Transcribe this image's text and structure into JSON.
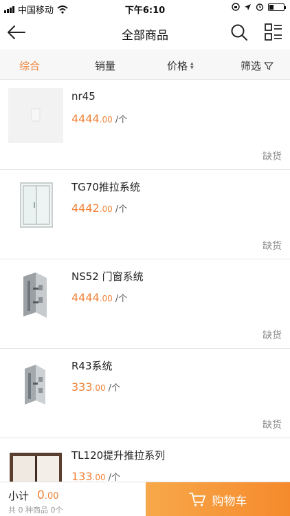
{
  "status_bar": {
    "carrier": "中国移动",
    "time": "下午6:10",
    "battery_level": 0.3
  },
  "header": {
    "title": "全部商品",
    "icons": [
      "back-arrow-icon",
      "search-icon",
      "list-view-icon"
    ]
  },
  "sort_bar": {
    "items": [
      {
        "label": "综合"
      },
      {
        "label": "销量"
      },
      {
        "label": "价格"
      },
      {
        "label": "筛选"
      }
    ],
    "active_index": 0,
    "icons": [
      "sort-arrows-icon",
      "filter-icon"
    ]
  },
  "products": [
    {
      "name": "nr45",
      "price_int": "4444",
      "price_dec": ".00",
      "unit": "/个",
      "status": "缺货",
      "image": "placeholder-image"
    },
    {
      "name": "TG70推拉系统",
      "price_int": "4442",
      "price_dec": ".00",
      "unit": "/个",
      "status": "缺货",
      "image": "window-frame-image"
    },
    {
      "name": "NS52 门窗系统",
      "price_int": "4444",
      "price_dec": ".00",
      "unit": "/个",
      "status": "缺货",
      "image": "aluminum-profile-image"
    },
    {
      "name": "R43系统",
      "price_int": "333",
      "price_dec": ".00",
      "unit": "/个",
      "status": "缺货",
      "image": "aluminum-profile-image"
    },
    {
      "name": "TL120提升推拉系列",
      "price_int": "133",
      "price_dec": ".00",
      "unit": "/个",
      "status": "",
      "image": "door-frame-image"
    }
  ],
  "footer": {
    "subtotal_label": "小计",
    "subtotal_int": "0",
    "subtotal_dec": ".00",
    "summary": "共 0 种商品 0个",
    "cart_label": "购物车",
    "icons": [
      "cart-icon"
    ]
  },
  "colors": {
    "accent": "#f0843a",
    "cart_gradient_start": "#f7a84a",
    "cart_gradient_end": "#f58a2c"
  }
}
